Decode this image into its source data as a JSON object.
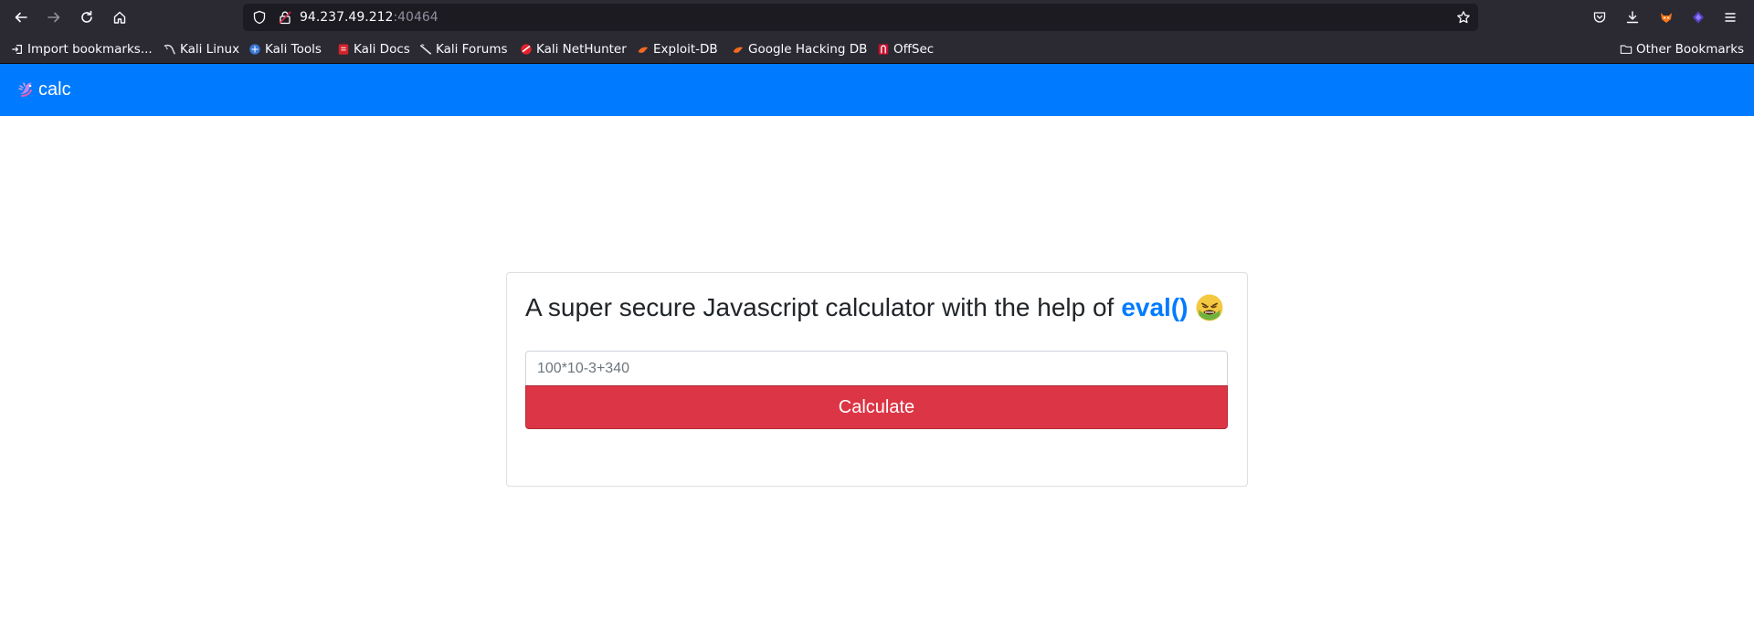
{
  "browser": {
    "url_host": "94.237.49.212",
    "url_port": ":40464",
    "bookmarks": [
      {
        "label": "Import bookmarks...",
        "icon": "import-icon"
      },
      {
        "label": "Kali Linux",
        "icon": "kali-dragon-icon"
      },
      {
        "label": "Kali Tools",
        "icon": "kali-tools-icon"
      },
      {
        "label": "Kali Docs",
        "icon": "kali-docs-icon"
      },
      {
        "label": "Kali Forums",
        "icon": "kali-forums-icon"
      },
      {
        "label": "Kali NetHunter",
        "icon": "nethunter-icon"
      },
      {
        "label": "Exploit-DB",
        "icon": "exploit-db-icon"
      },
      {
        "label": "Google Hacking DB",
        "icon": "ghdb-icon"
      },
      {
        "label": "OffSec",
        "icon": "offsec-icon"
      }
    ],
    "other_bookmarks": "Other Bookmarks"
  },
  "navbar": {
    "brand": "calc",
    "color": "#007bff"
  },
  "card": {
    "title_prefix": "A super secure Javascript calculator with the help of",
    "title_highlight": "eval()",
    "emoji": "nauseated-face-icon",
    "input_placeholder": "100*10-3+340",
    "input_value": "",
    "button_label": "Calculate",
    "button_color": "#dc3545"
  }
}
